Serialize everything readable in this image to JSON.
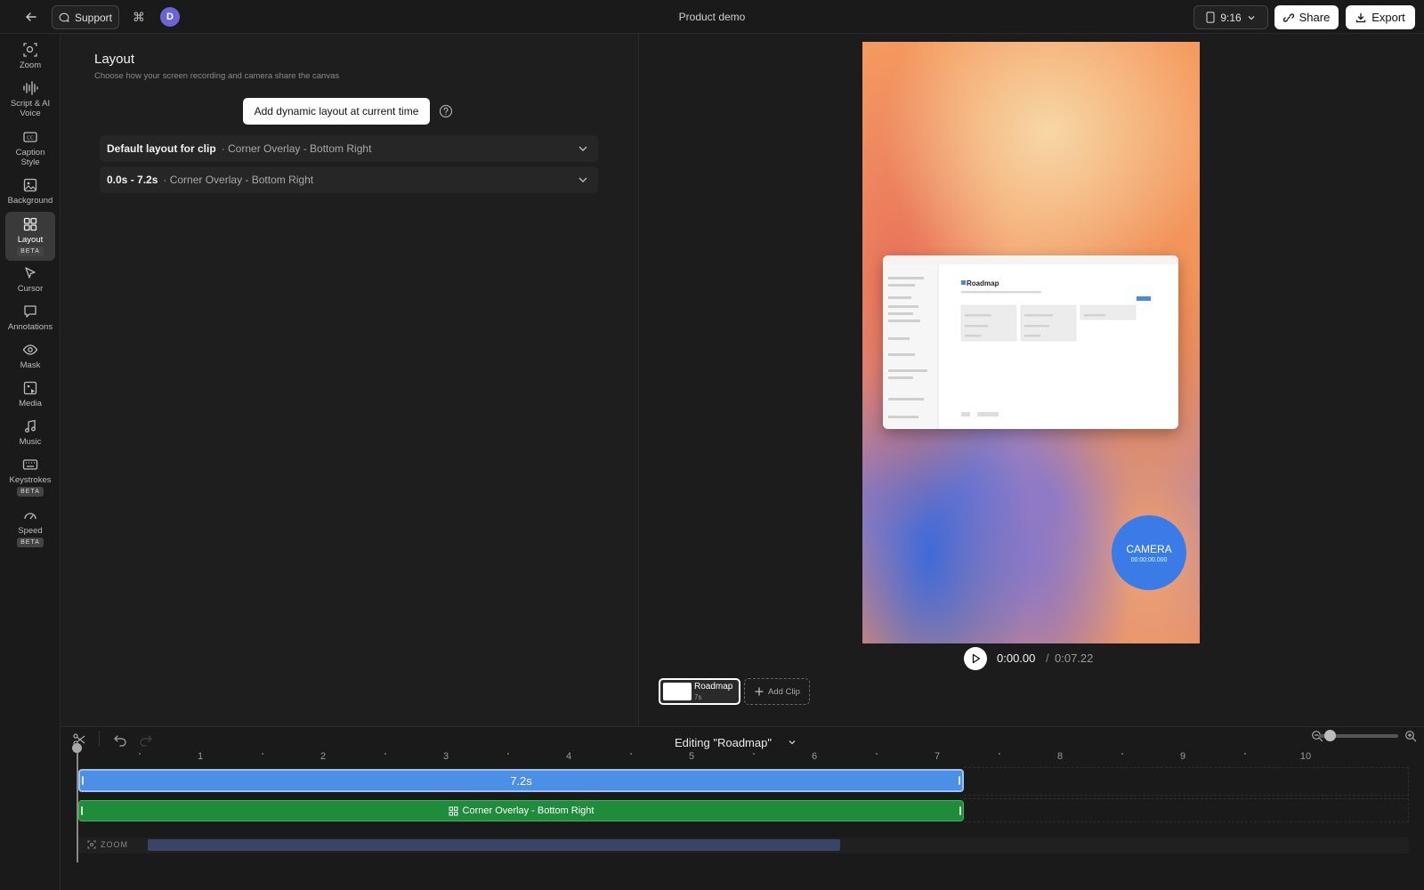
{
  "topbar": {
    "support_label": "Support",
    "avatar_initial": "D",
    "title": "Product demo",
    "ratio_label": "9:16",
    "share_label": "Share",
    "export_label": "Export"
  },
  "sidebar": {
    "items": [
      {
        "label": "Zoom",
        "icon": "zoom-icon"
      },
      {
        "label": "Script & AI Voice",
        "icon": "waveform-icon"
      },
      {
        "label": "Caption Style",
        "icon": "caption-icon"
      },
      {
        "label": "Background",
        "icon": "image-icon"
      },
      {
        "label": "Layout",
        "icon": "grid-icon",
        "badge": "BETA",
        "active": true
      },
      {
        "label": "Cursor",
        "icon": "cursor-icon"
      },
      {
        "label": "Annotations",
        "icon": "comment-icon"
      },
      {
        "label": "Mask",
        "icon": "eye-icon"
      },
      {
        "label": "Media",
        "icon": "media-icon"
      },
      {
        "label": "Music",
        "icon": "music-icon"
      },
      {
        "label": "Keystrokes",
        "icon": "keyboard-icon",
        "badge": "BETA"
      },
      {
        "label": "Speed",
        "icon": "gauge-icon",
        "badge": "BETA"
      }
    ]
  },
  "panel": {
    "title": "Layout",
    "subtitle": "Choose how your screen recording and camera share the canvas",
    "add_button": "Add dynamic layout at current time",
    "rows": [
      {
        "strong": "Default layout for clip",
        "light": "· Corner Overlay - Bottom Right"
      },
      {
        "strong": "0.0s - 7.2s",
        "light": "· Corner Overlay - Bottom Right"
      }
    ]
  },
  "preview": {
    "screen_title": "Roadmap",
    "camera_label": "CAMERA",
    "camera_time": "00:00:00.000",
    "time_current": "0:00.00",
    "time_separator": "/",
    "time_total": "0:07.22",
    "clip_name": "Roadmap",
    "clip_duration": "7s",
    "add_clip_label": "Add Clip"
  },
  "timeline": {
    "title": "Editing \"Roadmap\"",
    "ticks": [
      "1",
      "2",
      "3",
      "4",
      "5",
      "6",
      "7",
      "8",
      "9",
      "10"
    ],
    "clip_label": "7.2s",
    "layout_label": "Corner Overlay - Bottom Right",
    "zoom_label": "ZOOM"
  }
}
